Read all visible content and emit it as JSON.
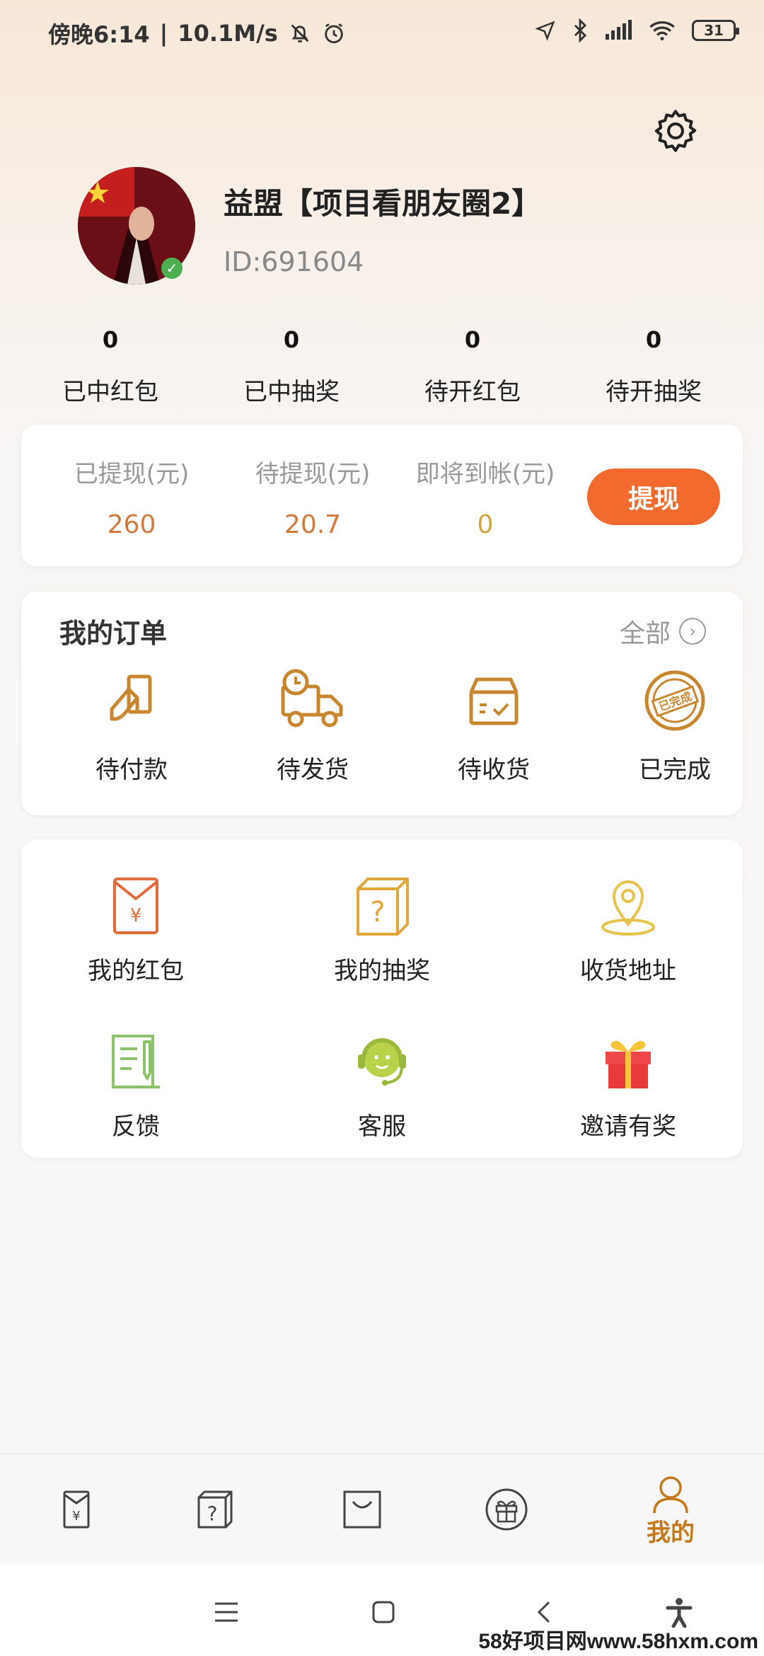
{
  "status_bar": {
    "time": "傍晚6:14",
    "speed": "10.1M/s",
    "battery": "31"
  },
  "profile": {
    "name": "益盟【项目看朋友圈2】",
    "id": "ID:691604"
  },
  "stats": [
    {
      "value": "0",
      "label": "已中红包"
    },
    {
      "value": "0",
      "label": "已中抽奖"
    },
    {
      "value": "0",
      "label": "待开红包"
    },
    {
      "value": "0",
      "label": "待开抽奖"
    }
  ],
  "wallet": {
    "withdrawn_label": "已提现(元)",
    "withdrawn_value": "260",
    "pending_label": "待提现(元)",
    "pending_value": "20.7",
    "arriving_label": "即将到帐(元)",
    "arriving_value": "0",
    "button": "提现",
    "colors": {
      "value": "#d07a3e",
      "arriving": "#d6a53a",
      "button": "#f26a2e"
    }
  },
  "orders": {
    "title": "我的订单",
    "all": "全部",
    "items": [
      {
        "label": "待付款",
        "icon": "payment-icon"
      },
      {
        "label": "待发货",
        "icon": "delivery-truck-icon"
      },
      {
        "label": "待收货",
        "icon": "package-box-icon"
      },
      {
        "label": "已完成",
        "icon": "completed-stamp-icon",
        "stamp_text": "已完成"
      }
    ]
  },
  "services": {
    "items": [
      {
        "label": "我的红包",
        "icon": "red-envelope-icon",
        "glyph": "¥"
      },
      {
        "label": "我的抽奖",
        "icon": "mystery-box-icon",
        "glyph": "?"
      },
      {
        "label": "收货地址",
        "icon": "location-pin-icon"
      },
      {
        "label": "反馈",
        "icon": "feedback-icon"
      },
      {
        "label": "客服",
        "icon": "customer-service-icon"
      },
      {
        "label": "邀请有奖",
        "icon": "gift-icon"
      }
    ]
  },
  "bottom_nav": {
    "items": [
      {
        "icon": "red-envelope-icon",
        "glyph": "¥"
      },
      {
        "icon": "mystery-box-icon",
        "glyph": "?"
      },
      {
        "icon": "shopping-bag-icon"
      },
      {
        "icon": "gift-circle-icon"
      },
      {
        "icon": "profile-icon",
        "label": "我的",
        "active": true
      }
    ],
    "active_color": "#c47a1c"
  },
  "watermark": "58好项目网www.58hxm.com"
}
